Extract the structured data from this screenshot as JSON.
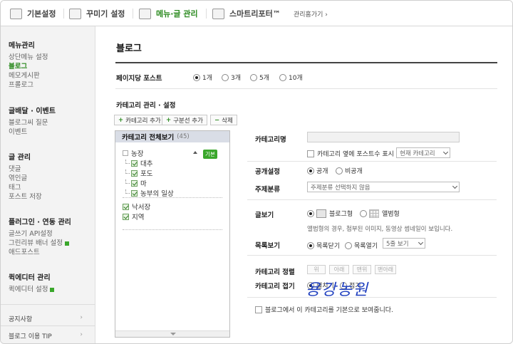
{
  "topnav": {
    "tabs": [
      {
        "label": "기본설정",
        "icon": "settings-icon"
      },
      {
        "label": "꾸미기 설정",
        "icon": "design-icon"
      },
      {
        "label": "메뉴·글 관리",
        "icon": "menu-icon"
      },
      {
        "label": "스마트리포터™",
        "icon": "report-icon"
      }
    ],
    "more": "관리홈가기 ›"
  },
  "sidebar": {
    "groups": [
      {
        "title": "메뉴관리",
        "items": [
          "상단메뉴 설정",
          "블로그",
          "메모게시판",
          "프롤로그"
        ],
        "selected": 1
      },
      {
        "title": "글배달 · 이벤트",
        "items": [
          "블로그씨 질문",
          "이벤트"
        ]
      },
      {
        "title": "글 관리",
        "items": [
          "댓글",
          "엮인글",
          "태그",
          "포스트 저장"
        ]
      },
      {
        "title": "플러그인 · 연동 관리",
        "items": [
          "글쓰기 API설정",
          "그린리뷰 배너 설정",
          "애드포스트"
        ]
      },
      {
        "title": "퀵에디터 관리",
        "items": [
          "퀵에디터 설정"
        ]
      }
    ],
    "footer": [
      {
        "label": "공지사항",
        "arrow": "›"
      },
      {
        "label": "블로그 이용 TIP",
        "arrow": "›"
      }
    ]
  },
  "main": {
    "title": "블로그",
    "posts_per_page": {
      "label": "페이지당 포스트",
      "options": [
        "1개",
        "3개",
        "5개",
        "10개"
      ],
      "selected": "1개"
    },
    "category_section": {
      "title": "카테고리 관리 · 설정",
      "buttons": {
        "add_category": "카테고리 추가",
        "add_divider": "구분선 추가",
        "delete": "삭제"
      },
      "tree": {
        "all_label": "카테고리 전체보기",
        "count": "(45)",
        "badge": "기본",
        "nodes": [
          {
            "label": "농장",
            "level": 0,
            "type": "folder"
          },
          {
            "label": "대추",
            "level": 1,
            "type": "checked"
          },
          {
            "label": "포도",
            "level": 1,
            "type": "checked"
          },
          {
            "label": "마",
            "level": 1,
            "type": "checked"
          },
          {
            "label": "농부의 일상",
            "level": 1,
            "type": "checked"
          },
          {
            "label": "낙서장",
            "level": 0,
            "type": "checked"
          },
          {
            "label": "지역",
            "level": 0,
            "type": "checked"
          }
        ]
      }
    },
    "form": {
      "category_name": {
        "label": "카테고리명",
        "value": ""
      },
      "no_category_post_count": {
        "label": "카테고리 옆에 포스트수 표시",
        "select": "현재 카테고리"
      },
      "visibility": {
        "label": "공개설정",
        "options": [
          "공개",
          "비공개"
        ],
        "selected": "공개"
      },
      "topic": {
        "label": "주제분류",
        "select": "주제분류 선택하지 않음"
      },
      "view_type": {
        "label": "글보기",
        "options": [
          "블로그형",
          "앨범형"
        ],
        "selected": "블로그형",
        "note": "앨범형의 경우, 첨부된 이미지, 동영상 썸네일이 보입니다."
      },
      "list_view": {
        "label": "목록보기",
        "options": [
          "목록닫기",
          "목록열기"
        ],
        "selected": "목록닫기",
        "select": "5줄 보기"
      },
      "sort": {
        "label": "카테고리 정렬",
        "buttons": [
          "위",
          "아래",
          "맨위",
          "맨아래"
        ]
      },
      "collapse": {
        "label": "카테고리 접기",
        "options": [
          "펼치기",
          "접기"
        ],
        "selected": "펼치기"
      },
      "default_view": {
        "label": "블로그에서 이 카테고리를 기본으로 보여줍니다."
      }
    }
  },
  "watermark": "용강농원"
}
